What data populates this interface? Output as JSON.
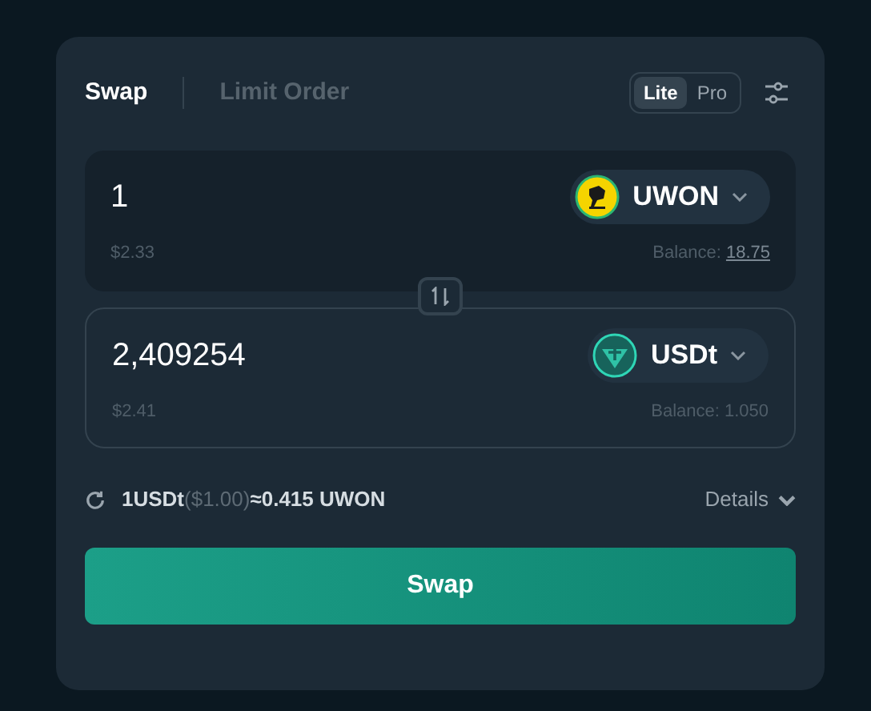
{
  "tabs": [
    {
      "label": "Swap",
      "selected": true
    },
    {
      "label": "Limit Order",
      "selected": false
    }
  ],
  "modes": [
    {
      "label": "Lite",
      "selected": true
    },
    {
      "label": "Pro",
      "selected": false
    }
  ],
  "panels": [
    {
      "kind": "from",
      "amount": "1",
      "usd": "$2.33",
      "token": "UWON",
      "balance_label": "Balance:",
      "balance": "18.75",
      "balance_link": true
    },
    {
      "kind": "to",
      "amount": "2,409254",
      "usd": "$2.41",
      "token": "USDt",
      "balance_label": "Balance:",
      "balance": "1.050",
      "balance_link": false
    }
  ],
  "rate": {
    "from": "1USDt",
    "usd": "($1.00)",
    "to": "≈0.415 UWON"
  },
  "details": "Details",
  "swap_button": "Swap"
}
